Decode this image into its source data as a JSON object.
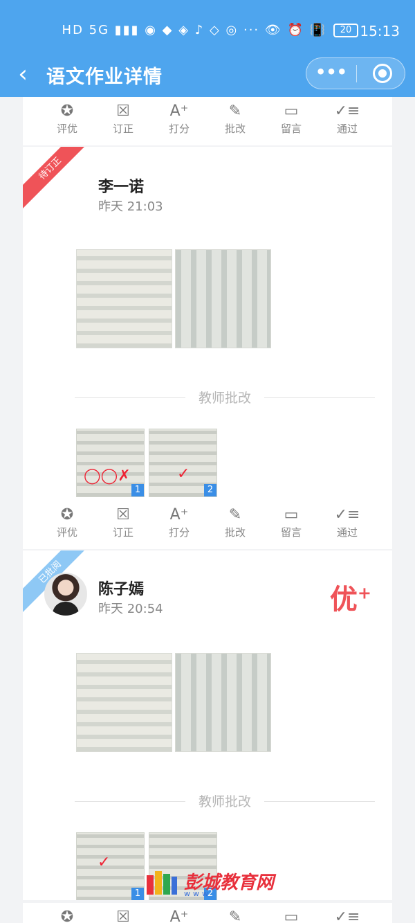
{
  "status_bar": {
    "icons_text": "HD 5G ▮▮▮ ◉ ◆ ◈ ♪ ◇ ◎ ··· 👁 ⏰ 📳",
    "battery": "20",
    "time": "15:13"
  },
  "nav": {
    "title": "语文作业详情",
    "more_label": "•••"
  },
  "toolbar_labels": {
    "excellent": "评优",
    "correct": "订正",
    "score": "打分",
    "grade": "批改",
    "message": "留言",
    "pass": "通过"
  },
  "submissions": [
    {
      "ribbon": "待订正",
      "name": "李一诺",
      "time": "昨天 21:03",
      "grade": "",
      "section_label": "教师批改",
      "thumb_badges": [
        "1",
        "2"
      ]
    },
    {
      "ribbon": "已批阅",
      "name": "陈子嫣",
      "time": "昨天 20:54",
      "grade": "优",
      "section_label": "教师批改",
      "thumb_badges": [
        "1",
        "2"
      ]
    }
  ],
  "watermark": {
    "text": "彭城教育网",
    "sub": "www"
  },
  "colors": {
    "accent": "#4ea5ee",
    "ribbon_red": "#ef5358",
    "ribbon_blue": "#8ec8f5",
    "grade_red": "#ef5358"
  }
}
